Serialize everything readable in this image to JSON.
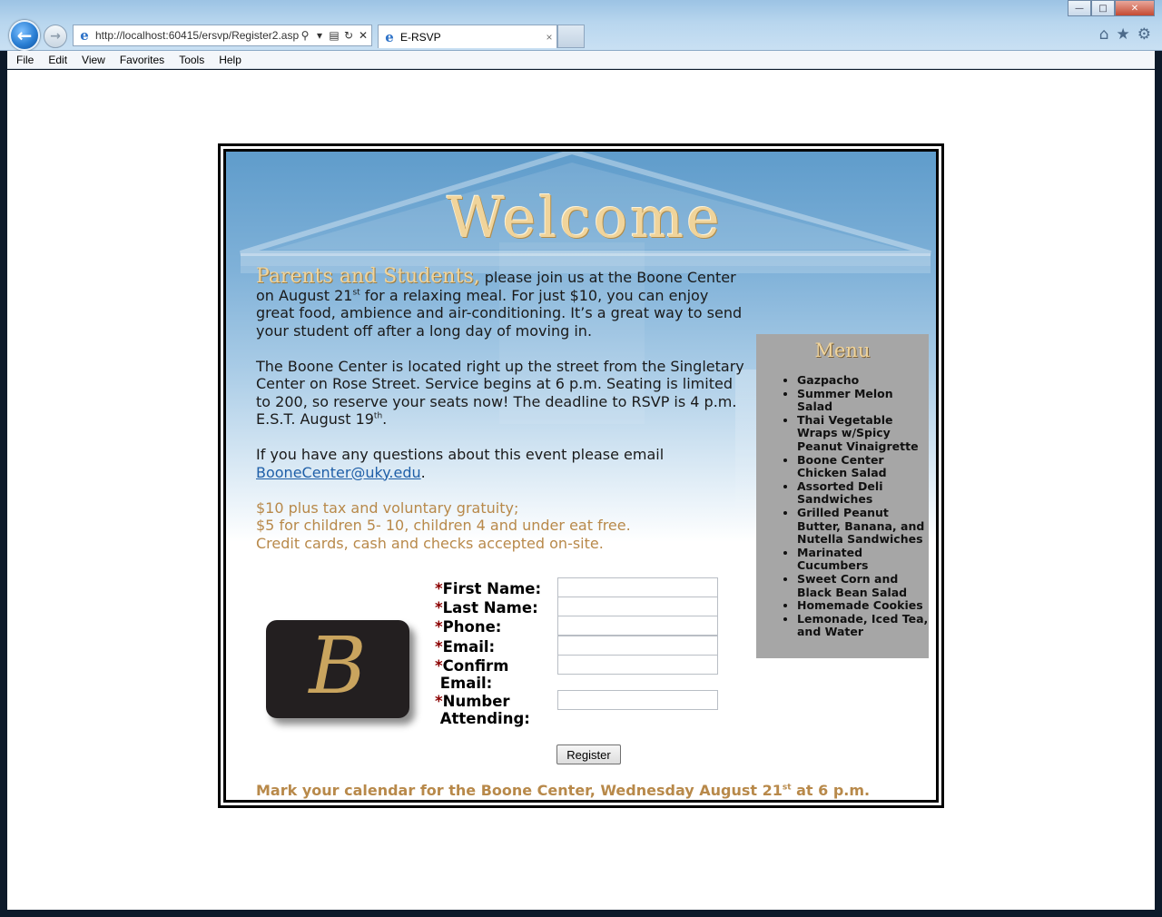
{
  "browser": {
    "url": "http://localhost:60415/ersvp/Register2.asp",
    "tab_title": "E-RSVP",
    "tab_close": "×"
  },
  "menubar": {
    "items": [
      "File",
      "Edit",
      "View",
      "Favorites",
      "Tools",
      "Help"
    ]
  },
  "hero": {
    "title": "Welcome"
  },
  "intro": {
    "lead": "Parents and Students,",
    "p1_a": " please join us at the Boone Center on August 21",
    "p1_sup": "st",
    "p1_b": " for a relaxing meal. For just $10, you can enjoy great food, ambience and air-conditioning. It’s a great way to send your student off after a long day of moving in.",
    "p2_a": "The Boone Center is located right up the street from the Singletary Center on Rose Street. Service begins at 6 p.m. Seating is limited to 200, so reserve your seats now! The deadline to RSVP is 4 p.m. E.S.T. August 19",
    "p2_sup": "th",
    "p2_b": ".",
    "p3_a": "If you have any questions about this event please email ",
    "email_link": "BooneCenter@uky.edu",
    "p3_b": ".",
    "pricing_1": "$10 plus tax and voluntary gratuity;",
    "pricing_2": "$5 for children 5- 10, children 4 and under eat free.",
    "pricing_3": "Credit cards, cash and checks accepted on-site."
  },
  "menu": {
    "title": "Menu",
    "items": [
      "Gazpacho",
      "Summer Melon Salad",
      "Thai Vegetable Wraps w/Spicy Peanut Vinaigrette",
      "Boone Center Chicken Salad",
      "Assorted Deli Sandwiches",
      "Grilled Peanut Butter, Banana, and Nutella Sandwiches",
      "Marinated Cucumbers",
      "Sweet Corn and Black Bean Salad",
      "Homemade Cookies",
      "Lemonade, Iced Tea, and Water"
    ]
  },
  "logo": {
    "letter": "B"
  },
  "form": {
    "required_mark": "*",
    "first_name_label": "First Name:",
    "last_name_label": "Last Name:",
    "phone_label": "Phone:",
    "email_label": "Email:",
    "confirm_email_label_1": "Confirm",
    "confirm_email_label_2": "Email:",
    "number_attending_label_1": "Number",
    "number_attending_label_2": "Attending:",
    "first_name_value": "",
    "last_name_value": "",
    "phone_value": "",
    "email_value": "",
    "confirm_email_value": "",
    "number_attending_value": "",
    "register_label": "Register"
  },
  "footer": {
    "note_a": "Mark your calendar for the Boone Center, Wednesday August 21",
    "note_sup": "st",
    "note_b": " at 6 p.m."
  },
  "colors": {
    "gold": "#f0d49b",
    "pricing": "#b8894a",
    "link": "#1f5fa8",
    "required": "#8b0000",
    "menu_panel": "#a6a6a6"
  }
}
